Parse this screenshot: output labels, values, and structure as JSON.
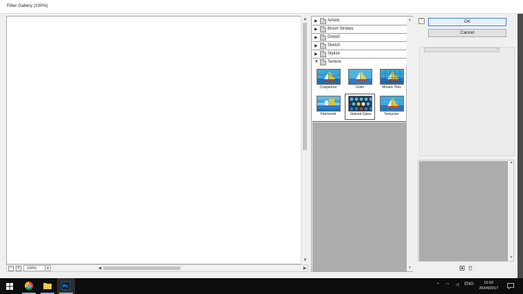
{
  "window": {
    "title": "Filter Gallery (100%)"
  },
  "preview": {
    "zoom": "100%",
    "zoom_out_label": "−",
    "zoom_in_label": "+",
    "arrow_up": "▲",
    "arrow_down": "▼",
    "arrow_left": "◀",
    "arrow_right": "▶"
  },
  "filters": {
    "categories": [
      {
        "label": "Artistic",
        "expanded": false
      },
      {
        "label": "Brush Strokes",
        "expanded": false
      },
      {
        "label": "Distort",
        "expanded": false
      },
      {
        "label": "Sketch",
        "expanded": false
      },
      {
        "label": "Stylize",
        "expanded": false
      },
      {
        "label": "Texture",
        "expanded": true
      }
    ],
    "texture_items": [
      {
        "label": "Craquelure"
      },
      {
        "label": "Grain"
      },
      {
        "label": "Mosaic Tiles"
      },
      {
        "label": "Patchwork"
      },
      {
        "label": "Stained Glass",
        "selected": true
      },
      {
        "label": "Texturizer"
      }
    ],
    "collapsed_glyph": "▶",
    "expanded_glyph": "▼"
  },
  "controls": {
    "ok_label": "OK",
    "cancel_label": "Cancel",
    "collapse_glyph": "⌃"
  },
  "taskbar": {
    "language": "ENG",
    "time": "15:02",
    "date": "25/04/2017",
    "tray_glyphs": {
      "up": "⌃",
      "wifi": "◠",
      "volume": "◁"
    }
  },
  "colors": {
    "accent": "#3d7cc9",
    "sky": "#3aa6d8",
    "sea": "#1f6fb5",
    "sail": "#e8c21a",
    "taskbar_underline": "#7aa7d8"
  }
}
